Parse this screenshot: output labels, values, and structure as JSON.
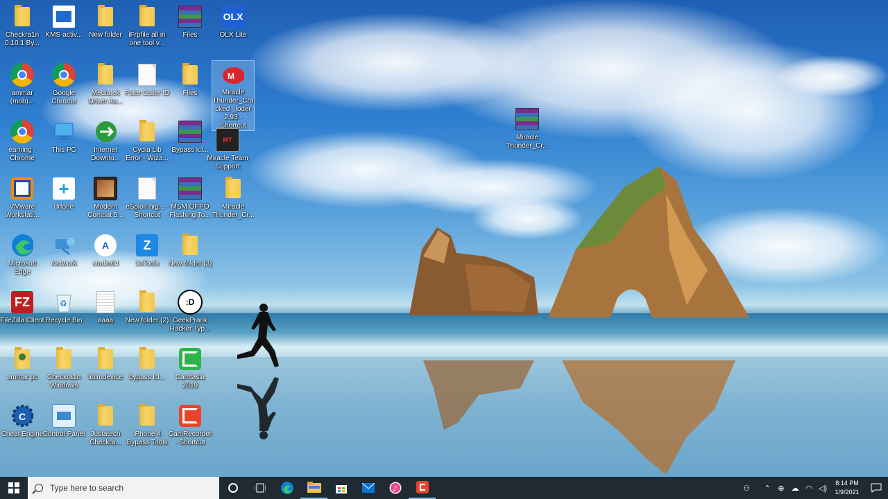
{
  "desktop": {
    "icons": [
      {
        "label": "Checkra1n 0.10.1 By...",
        "icon": "folder-icon"
      },
      {
        "label": "KMS-activ...",
        "icon": "kms-app-icon"
      },
      {
        "label": "New folder",
        "icon": "folder-icon"
      },
      {
        "label": "iFrpfile all in one tool v...",
        "icon": "folder-icon"
      },
      {
        "label": "Files",
        "icon": "winrar-icon"
      },
      {
        "label": "OLX Lite",
        "icon": "olx-icon"
      },
      {
        "label": "ammar (mob)...",
        "icon": "chrome-icon"
      },
      {
        "label": "Google Chrome",
        "icon": "chrome-icon"
      },
      {
        "label": "Mediatek Driver Au...",
        "icon": "folder-icon"
      },
      {
        "label": "Fake Caller ID",
        "icon": "file-icon"
      },
      {
        "label": "Files",
        "icon": "folder-icon"
      },
      {
        "label": "Miracle Thunder_Cra cked _loder 2.93 - Shortcut",
        "icon": "miracle-icon"
      },
      {
        "label": "earning - Chrome",
        "icon": "chrome-icon"
      },
      {
        "label": "This PC",
        "icon": "pc-icon"
      },
      {
        "label": "Internet Downlo...",
        "icon": "idm-icon"
      },
      {
        "label": "Cydia Lib Error - Wiza...",
        "icon": "folder-icon"
      },
      {
        "label": "Bypass icl...",
        "icon": "winrar-icon"
      },
      {
        "label": "Miracle Team Support",
        "icon": "miracle-team-icon"
      },
      {
        "label": "VMware Workstati...",
        "icon": "vmware-icon"
      },
      {
        "label": "drfone",
        "icon": "drfone-icon"
      },
      {
        "label": "Modern Combat 5...",
        "icon": "game-icon"
      },
      {
        "label": "eSploit-nig... - Shortcut",
        "icon": "file-icon"
      },
      {
        "label": "MSM OPPO Flashing To...",
        "icon": "winrar-icon"
      },
      {
        "label": "Miracle Thunder_Cr...",
        "icon": "folder-icon"
      },
      {
        "label": "Microsoft Edge",
        "icon": "edge-icon"
      },
      {
        "label": "Network",
        "icon": "network-icon"
      },
      {
        "label": "studio64",
        "icon": "android-studio-icon"
      },
      {
        "label": "3uTools",
        "icon": "3utools-icon"
      },
      {
        "label": "New folder (3)",
        "icon": "folder-icon"
      },
      {
        "label": "FileZilla Client",
        "icon": "filezilla-icon"
      },
      {
        "label": "Recycle Bin",
        "icon": "recycle-bin-icon"
      },
      {
        "label": "aaaa",
        "icon": "text-file-icon"
      },
      {
        "label": "New folder (2)",
        "icon": "folder-icon"
      },
      {
        "label": "GeekPrank Hacker Typ...",
        "icon": "troll-icon"
      },
      {
        "label": "ammar pc",
        "icon": "user-folder-icon"
      },
      {
        "label": "Checkra1n Windows",
        "icon": "folder-icon"
      },
      {
        "label": "libimdevice",
        "icon": "folder-icon"
      },
      {
        "label": "bypass icl...",
        "icon": "folder-icon"
      },
      {
        "label": "Camtasia 2019",
        "icon": "camtasia-icon"
      },
      {
        "label": "Cheat Engine",
        "icon": "cheat-engine-icon"
      },
      {
        "label": "Control Panel",
        "icon": "control-panel-icon"
      },
      {
        "label": "Justatech Checkra...",
        "icon": "folder-icon"
      },
      {
        "label": "iPhone 4 Bypass Tools",
        "icon": "folder-icon"
      },
      {
        "label": "CamRecorder - Shortcut",
        "icon": "camrecorder-icon"
      },
      {
        "label": "Miracle Thunder_Cr...",
        "icon": "winrar-icon"
      }
    ]
  },
  "taskbar": {
    "search_placeholder": "Type here to search",
    "clock_time": "8:14 PM",
    "clock_date": "1/9/2021"
  },
  "colors": {
    "taskbar": "#1f2a33",
    "folder": "#f1c84c",
    "accent": "#0078d7"
  }
}
